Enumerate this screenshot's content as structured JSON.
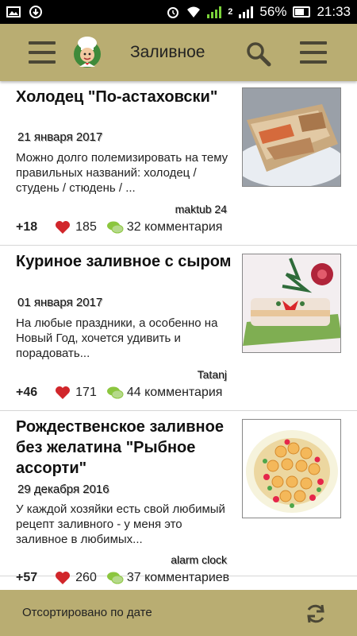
{
  "status_bar": {
    "battery": "56%",
    "time": "21:33",
    "sim": "2"
  },
  "app_bar": {
    "title": "Заливное",
    "menu_icon": "hamburger-icon",
    "logo_icon": "chef-logo-icon",
    "search_icon": "search-icon",
    "more_icon": "more-menu-icon"
  },
  "recipes": [
    {
      "title": "Холодец \"По-астаховски\"",
      "date": "21 января 2017",
      "description": "Можно долго полемизировать на тему правильных названий: холодец / студень / стюдень / ...",
      "author": "maktub 24",
      "score": "+18",
      "likes": "185",
      "comments": "32 комментария"
    },
    {
      "title": "Куриное заливное с сыром",
      "date": "01 января 2017",
      "description": "На любые праздники, а особенно на Новый Год, хочется удивить и порадовать...",
      "author": "Tatanj",
      "score": "+46",
      "likes": "171",
      "comments": "44 комментария"
    },
    {
      "title": "Рождественское заливное без желатина \"Рыбное ассорти\"",
      "date": "29 декабря 2016",
      "description": "У каждой хозяйки есть свой любимый рецепт заливного - у меня это заливное в любимых...",
      "author": "alarm clock",
      "score": "+57",
      "likes": "260",
      "comments": "37 комментариев"
    }
  ],
  "bottom_bar": {
    "sort_label": "Отсортировано по дате",
    "refresh_icon": "refresh-icon"
  },
  "colors": {
    "app_bar": "#b9ad72",
    "heart": "#d1262b",
    "comment_bubble": "#8cc63f"
  }
}
